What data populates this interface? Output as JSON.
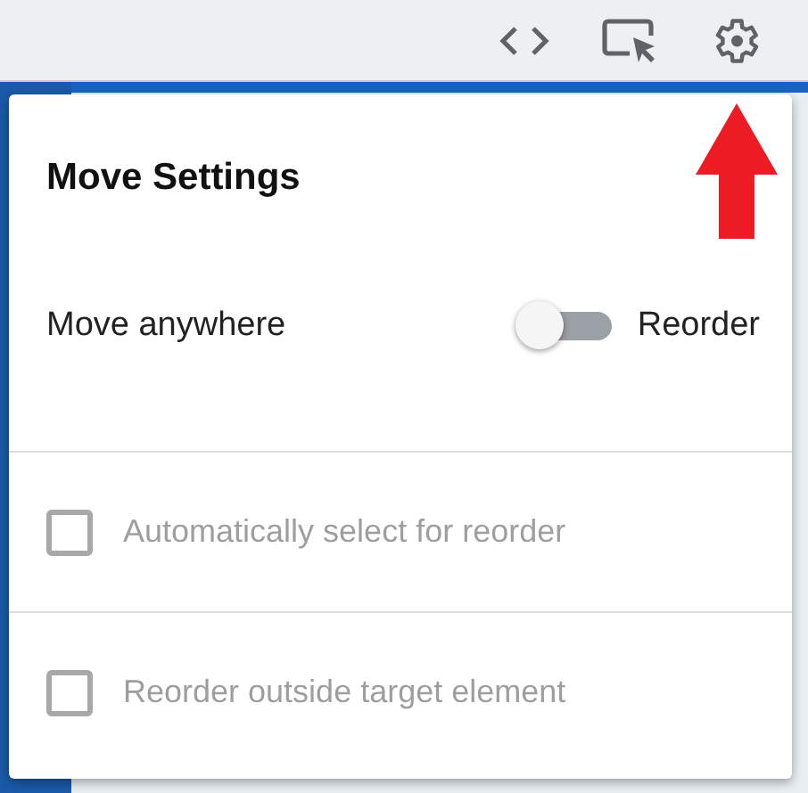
{
  "panel": {
    "title": "Move Settings",
    "mode_toggle": {
      "left_label": "Move anywhere",
      "right_label": "Reorder",
      "on": false
    },
    "options": [
      {
        "label": "Automatically select for reorder",
        "checked": false,
        "disabled": true
      },
      {
        "label": "Reorder outside target element",
        "checked": false,
        "disabled": true
      }
    ]
  }
}
